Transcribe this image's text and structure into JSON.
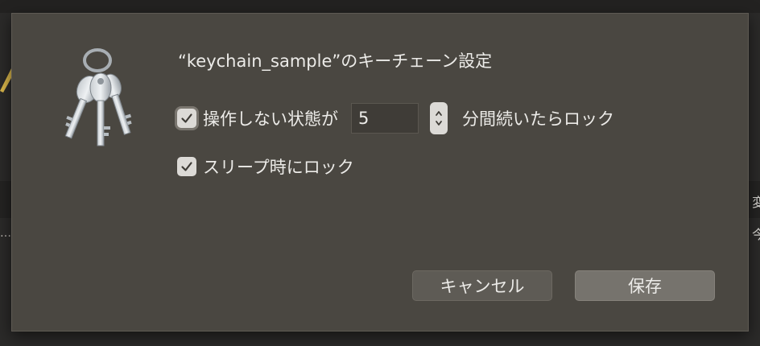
{
  "dialog": {
    "title": "“keychain_sample”のキーチェーン設定",
    "lock_after_idle": {
      "checked": true,
      "label_before": "操作しない状態が",
      "minutes": "5",
      "label_after": "分間続いたらロック"
    },
    "lock_on_sleep": {
      "checked": true,
      "label": "スリープ時にロック"
    },
    "buttons": {
      "cancel": "キャンセル",
      "save": "保存"
    }
  },
  "background_hints": {
    "right_char_1": "変",
    "right_char_2": "今",
    "left_ellipsis": "…"
  },
  "icons": {
    "app": "keychain-keys-icon",
    "check": "checkmark-icon",
    "stepper": "up-down-chevron-icon"
  },
  "colors": {
    "sheet_bg": "#4a4741",
    "checkbox_bg": "#dcdad6",
    "default_button": "#76736d"
  }
}
